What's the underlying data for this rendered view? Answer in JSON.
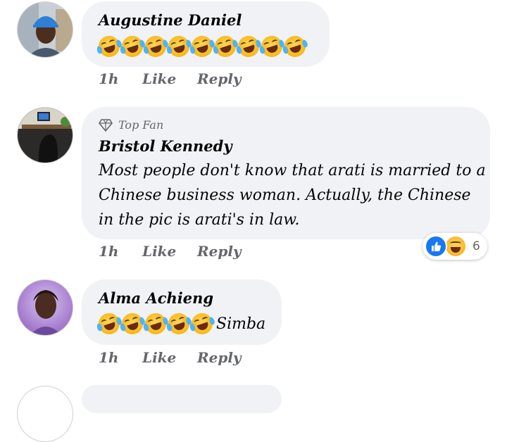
{
  "comments": [
    {
      "name": "Augustine Daniel",
      "emoji_count": 9,
      "emoji_icon": "rofl-emoji-icon",
      "time": "1h",
      "like": "Like",
      "reply": "Reply"
    },
    {
      "badge": "Top Fan",
      "name": "Bristol Kennedy",
      "lines": [
        "Most people don't know that arati is married to a",
        "Chinese business woman.   Actually, the Chinese",
        "in the pic is arati's in law."
      ],
      "time": "1h",
      "like": "Like",
      "reply": "Reply",
      "reactions": {
        "icons": [
          "like-reaction-icon",
          "haha-reaction-icon"
        ],
        "count": "6"
      }
    },
    {
      "name": "Alma Achieng",
      "emoji_count": 5,
      "emoji_icon": "rofl-emoji-icon",
      "trailing_text": "Simba",
      "time": "1h",
      "like": "Like",
      "reply": "Reply"
    }
  ],
  "colors": {
    "bubble": "#f0f2f5",
    "secondary_text": "#65676b",
    "like_blue": "#1877f2"
  }
}
